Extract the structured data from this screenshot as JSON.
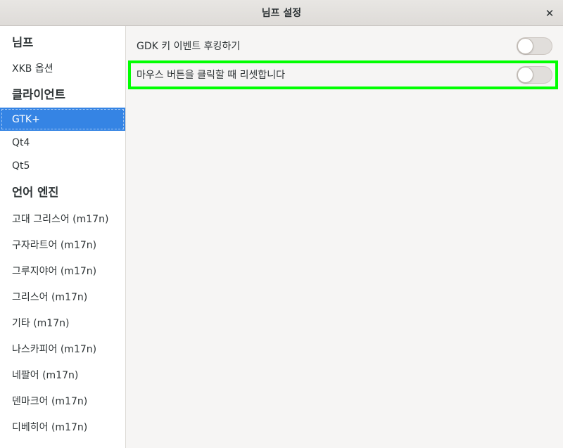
{
  "window": {
    "title": "님프 설정",
    "close_glyph": "✕"
  },
  "sidebar": {
    "sections": [
      {
        "header": "님프",
        "items": [
          {
            "label": "XKB 옵션"
          }
        ]
      },
      {
        "header": "클라이언트",
        "items": [
          {
            "label": "GTK+",
            "selected": true
          },
          {
            "label": "Qt4"
          },
          {
            "label": "Qt5"
          }
        ]
      },
      {
        "header": "언어 엔진",
        "items": [
          {
            "label": "고대 그리스어 (m17n)"
          },
          {
            "label": "구자라트어 (m17n)"
          },
          {
            "label": "그루지야어 (m17n)"
          },
          {
            "label": "그리스어 (m17n)"
          },
          {
            "label": "기타 (m17n)"
          },
          {
            "label": "나스카피어 (m17n)"
          },
          {
            "label": "네팔어 (m17n)"
          },
          {
            "label": "덴마크어 (m17n)"
          },
          {
            "label": "디베히어 (m17n)"
          }
        ]
      }
    ]
  },
  "settings": [
    {
      "label": "GDK 키 이벤트 후킹하기",
      "enabled": false
    },
    {
      "label": "마우스 버튼을 클릭할 때 리셋합니다",
      "enabled": false
    }
  ],
  "colors": {
    "selection": "#3584e4",
    "highlight": "#00ff00"
  }
}
